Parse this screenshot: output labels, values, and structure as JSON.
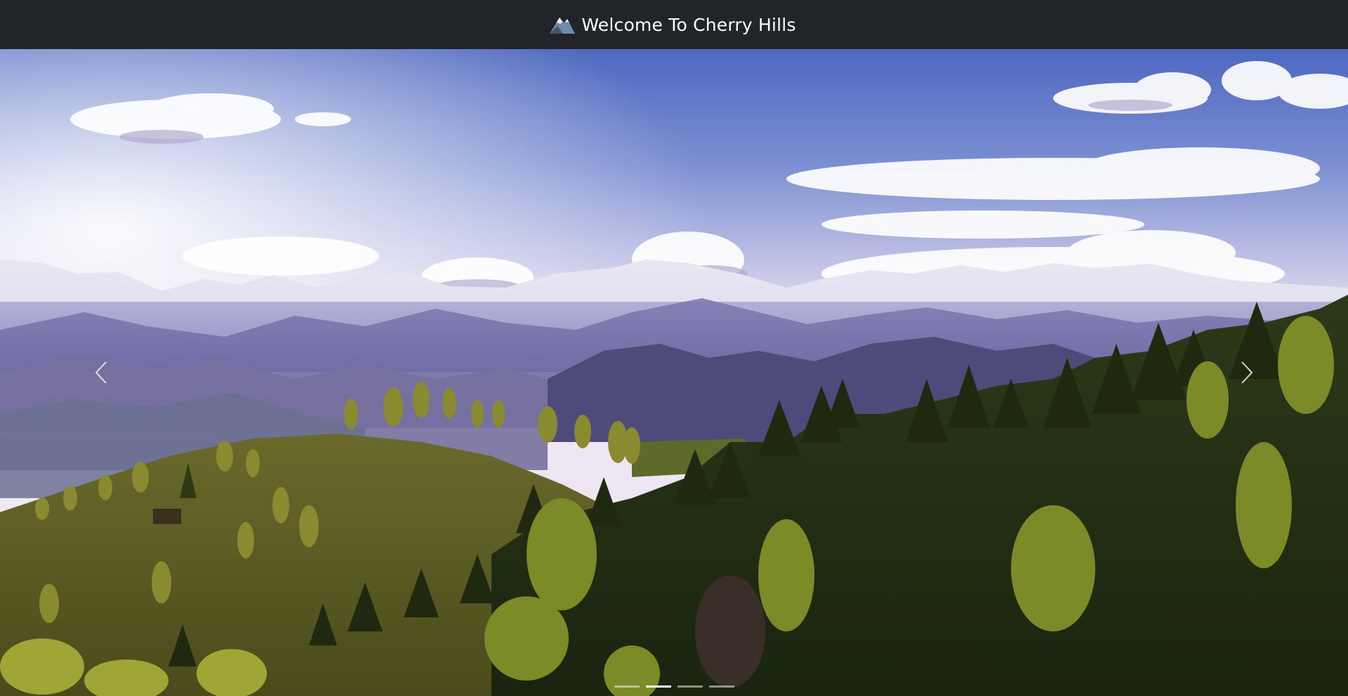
{
  "navbar": {
    "brand_text": "Welcome To Cherry Hills",
    "brand_icon": "mountain-icon"
  },
  "carousel": {
    "slide_count": 4,
    "active_index": 1,
    "prev_icon": "chevron-left-icon",
    "next_icon": "chevron-right-icon",
    "scene": "mountain-landscape"
  },
  "colors": {
    "navbar_bg": "#212529",
    "sky_top": "#5a74c4",
    "sky_horizon": "#ece4f2",
    "mountains": "#8a86b8",
    "forest_dark": "#1f2a14",
    "forest_light": "#8a8a2a"
  }
}
